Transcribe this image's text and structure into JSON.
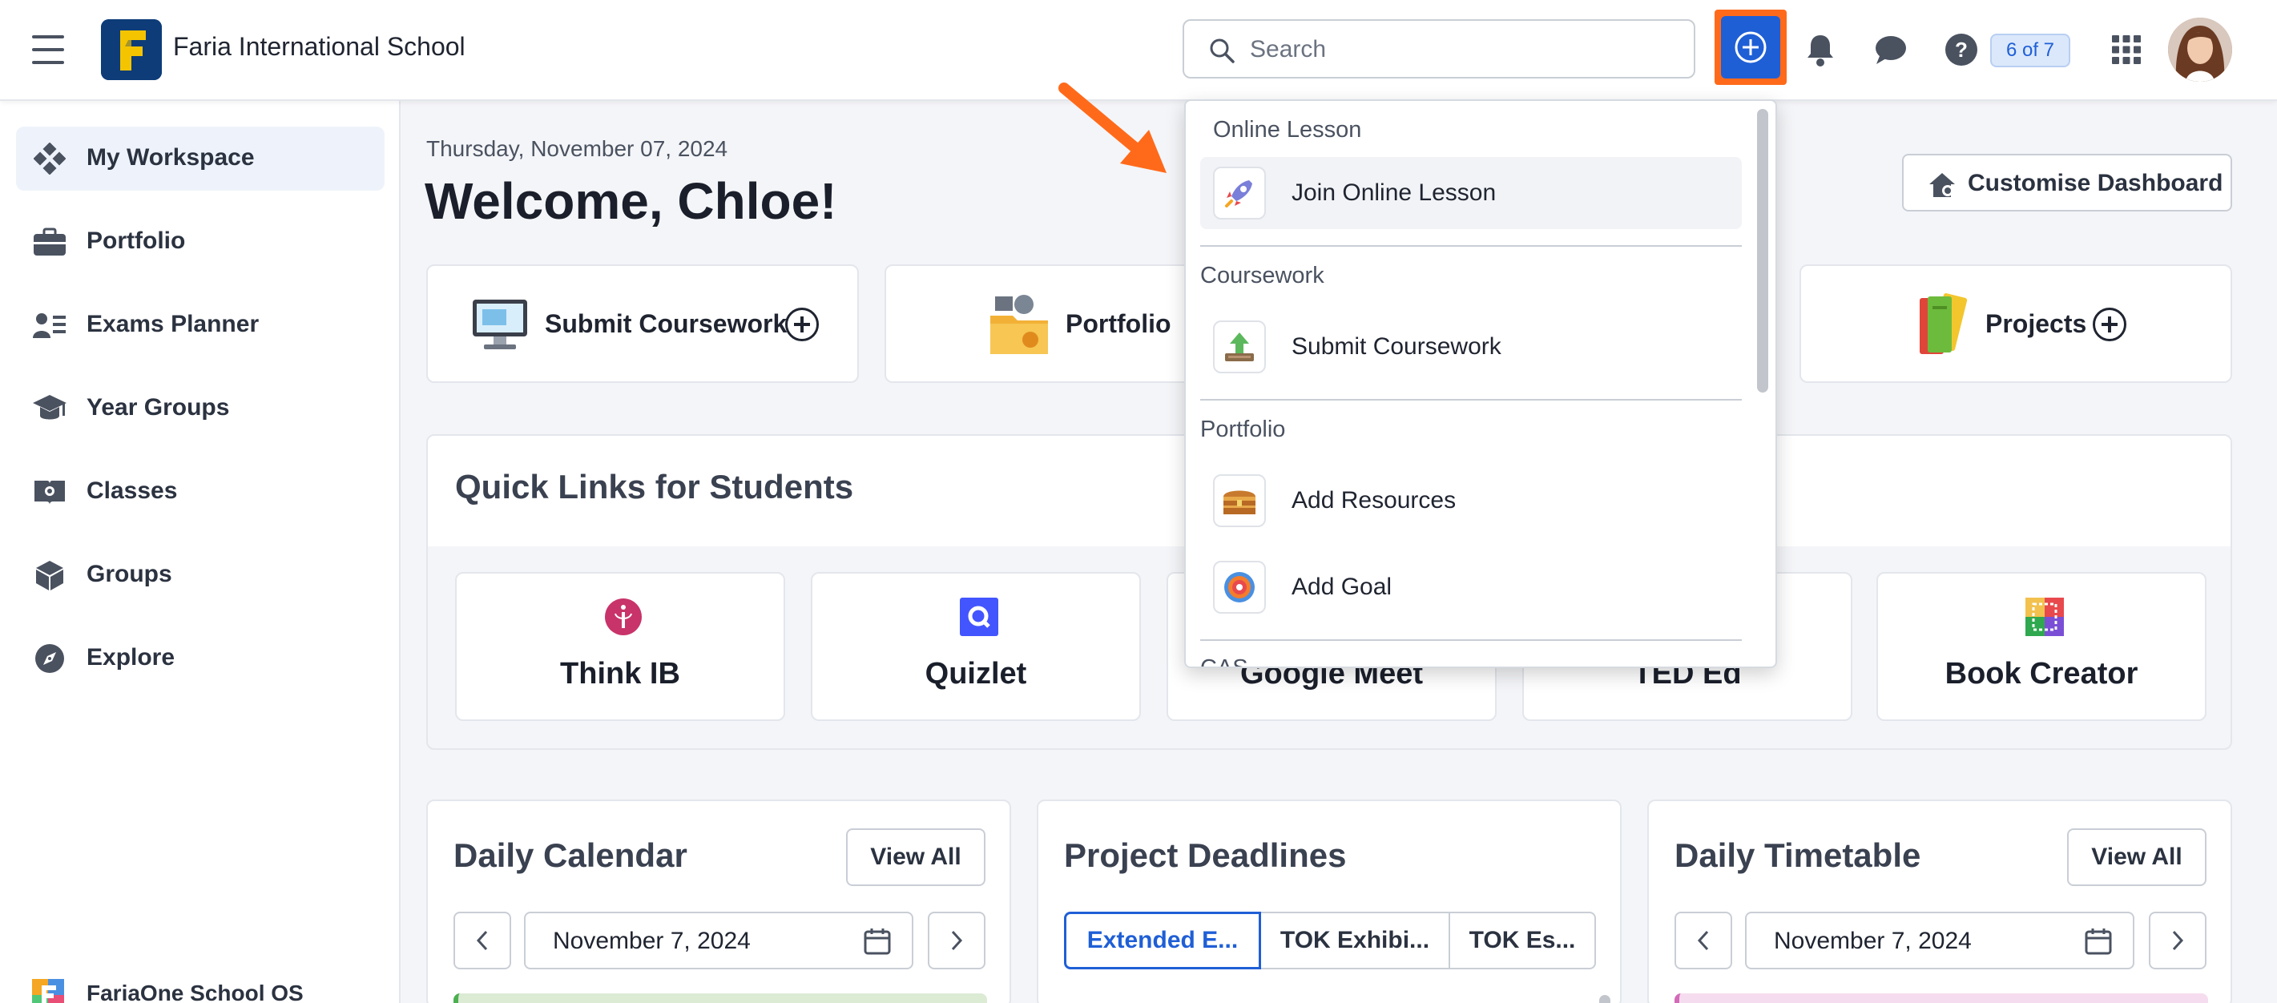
{
  "topbar": {
    "school_name": "Faria International School",
    "search_placeholder": "Search",
    "tour_badge": "6 of 7"
  },
  "sidebar": {
    "items": [
      {
        "label": "My Workspace",
        "icon": "workspace-icon",
        "active": true
      },
      {
        "label": "Portfolio",
        "icon": "briefcase-icon"
      },
      {
        "label": "Exams Planner",
        "icon": "exams-planner-icon"
      },
      {
        "label": "Year Groups",
        "icon": "graduation-cap-icon"
      },
      {
        "label": "Classes",
        "icon": "classes-book-icon"
      },
      {
        "label": "Groups",
        "icon": "cube-icon"
      },
      {
        "label": "Explore",
        "icon": "compass-icon"
      }
    ],
    "footer_label": "FariaOne School OS"
  },
  "main": {
    "date": "Thursday, November 07, 2024",
    "welcome": "Welcome, Chloe!",
    "customise_label": "Customise Dashboard",
    "action_cards": [
      {
        "label": "Submit Coursework",
        "icon": "computer-monitor-icon"
      },
      {
        "label": "Portfolio",
        "icon": "portfolio-folder-icon"
      },
      {
        "label": "Projects",
        "icon": "books-stack-icon"
      }
    ],
    "quick_links": {
      "title": "Quick Links for Students",
      "links": [
        {
          "label": "Think IB",
          "icon": "think-ib-icon"
        },
        {
          "label": "Quizlet",
          "icon": "quizlet-icon"
        },
        {
          "label": "Google Meet",
          "icon": "google-meet-icon"
        },
        {
          "label": "TED Ed",
          "icon": "ted-ed-icon"
        },
        {
          "label": "Book Creator",
          "icon": "book-creator-icon"
        }
      ]
    },
    "daily_calendar": {
      "title": "Daily Calendar",
      "view_all": "View All",
      "date": "November 7, 2024"
    },
    "project_deadlines": {
      "title": "Project Deadlines",
      "tabs": [
        "Extended E...",
        "TOK Exhibi...",
        "TOK Es..."
      ]
    },
    "daily_timetable": {
      "title": "Daily Timetable",
      "view_all": "View All",
      "date": "November 7, 2024"
    }
  },
  "dropdown": {
    "sections": [
      {
        "header": "Online Lesson",
        "items": [
          {
            "label": "Join Online Lesson",
            "icon": "rocket-icon"
          }
        ]
      },
      {
        "header": "Coursework",
        "items": [
          {
            "label": "Submit Coursework",
            "icon": "upload-tray-icon"
          }
        ]
      },
      {
        "header": "Portfolio",
        "items": [
          {
            "label": "Add Resources",
            "icon": "treasure-chest-icon"
          },
          {
            "label": "Add Goal",
            "icon": "target-icon"
          }
        ]
      },
      {
        "header": "CAS",
        "items": []
      }
    ]
  },
  "colors": {
    "brand_blue": "#1f5fd6",
    "highlight_orange": "#ff6a1a",
    "logo_navy": "#0d3c78",
    "logo_yellow": "#f5c400"
  }
}
